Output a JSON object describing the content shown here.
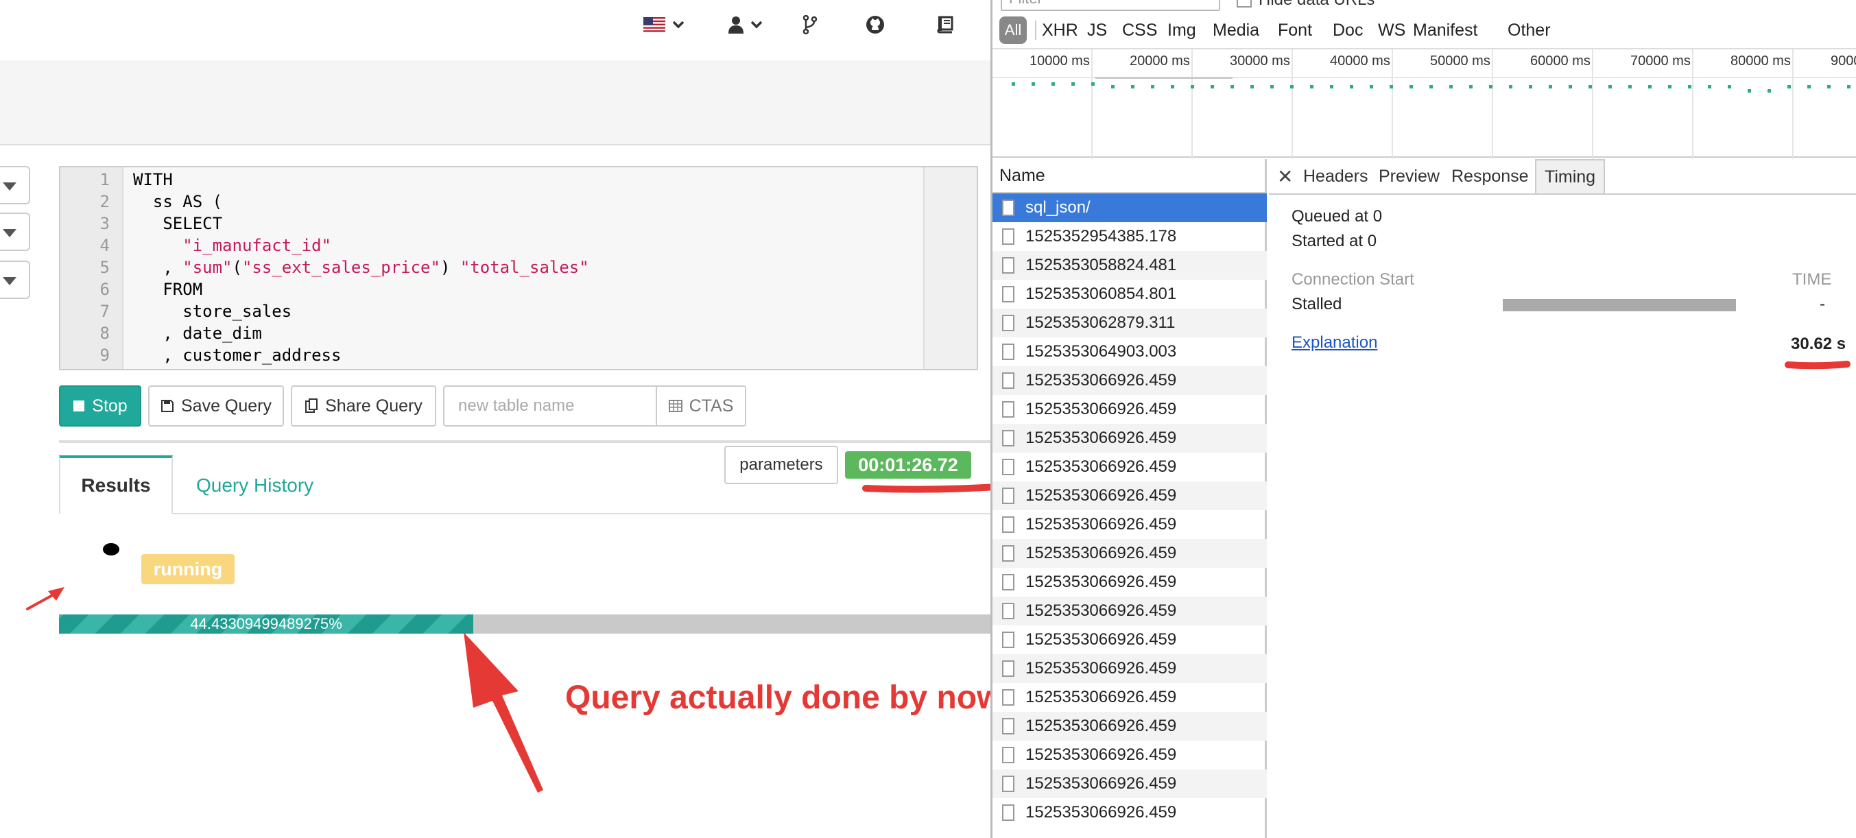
{
  "navbar": {
    "icons": [
      "us-flag-icon",
      "user-icon",
      "git-branch-icon",
      "github-icon",
      "book-icon"
    ]
  },
  "editor": {
    "line_numbers": [
      "1",
      "2",
      "3",
      "4",
      "5",
      "6",
      "7",
      "8",
      "9"
    ],
    "lines": [
      [
        {
          "t": "WITH",
          "c": "kw"
        }
      ],
      [
        {
          "t": "  ss ",
          "c": "kw"
        },
        {
          "t": "AS (",
          "c": "kw"
        }
      ],
      [
        {
          "t": "   SELECT",
          "c": "kw"
        }
      ],
      [
        {
          "t": "     ",
          "c": "kw"
        },
        {
          "t": "\"i_manufact_id\"",
          "c": "str"
        }
      ],
      [
        {
          "t": "   , ",
          "c": "kw"
        },
        {
          "t": "\"sum\"",
          "c": "str"
        },
        {
          "t": "(",
          "c": "kw"
        },
        {
          "t": "\"ss_ext_sales_price\"",
          "c": "str"
        },
        {
          "t": ") ",
          "c": "kw"
        },
        {
          "t": "\"total_sales\"",
          "c": "str"
        }
      ],
      [
        {
          "t": "   FROM",
          "c": "kw"
        }
      ],
      [
        {
          "t": "     store_sales",
          "c": "kw"
        }
      ],
      [
        {
          "t": "   , date_dim",
          "c": "kw"
        }
      ],
      [
        {
          "t": "   , customer_address",
          "c": "kw"
        }
      ]
    ]
  },
  "toolbar": {
    "stop_label": "Stop",
    "save_label": "Save Query",
    "share_label": "Share Query",
    "table_name_placeholder": "new table name",
    "ctas_label": "CTAS"
  },
  "tabs": {
    "results": "Results",
    "history": "Query History"
  },
  "parameters_label": "parameters",
  "timer": "00:01:26.72",
  "status": "running",
  "progress": {
    "percent": 44.43309499489275,
    "label": "44.43309499489275%"
  },
  "annotation": "Query actually done by now.",
  "colors": {
    "accent": "#20a89a",
    "timer_green": "#5cb85c",
    "running_badge": "#f9d77e",
    "annotation_red": "#e53935",
    "selected_row": "#3879d9"
  },
  "devtools": {
    "filter_placeholder": "Filter",
    "hide_data_urls": "Hide data URLs",
    "types": [
      "XHR",
      "JS",
      "CSS",
      "Img",
      "Media",
      "Font",
      "Doc",
      "WS",
      "Manifest",
      "Other"
    ],
    "all_label": "All",
    "timeline_ticks": [
      "10000 ms",
      "20000 ms",
      "30000 ms",
      "40000 ms",
      "50000 ms",
      "60000 ms",
      "70000 ms",
      "80000 ms",
      "9000"
    ],
    "name_header": "Name",
    "requests": [
      "sql_json/",
      "1525352954385.178",
      "1525353058824.481",
      "1525353060854.801",
      "1525353062879.311",
      "1525353064903.003",
      "1525353066926.459",
      "1525353066926.459",
      "1525353066926.459",
      "1525353066926.459",
      "1525353066926.459",
      "1525353066926.459",
      "1525353066926.459",
      "1525353066926.459",
      "1525353066926.459",
      "1525353066926.459",
      "1525353066926.459",
      "1525353066926.459",
      "1525353066926.459",
      "1525353066926.459",
      "1525353066926.459",
      "1525353066926.459"
    ],
    "detail_tabs": {
      "headers": "Headers",
      "preview": "Preview",
      "response": "Response",
      "timing": "Timing"
    },
    "timing": {
      "queued": "Queued at 0",
      "started": "Started at 0",
      "connection_start": "Connection Start",
      "time_col": "TIME",
      "stalled": "Stalled",
      "stalled_value": "-",
      "explanation": "Explanation",
      "total": "30.62 s"
    }
  }
}
